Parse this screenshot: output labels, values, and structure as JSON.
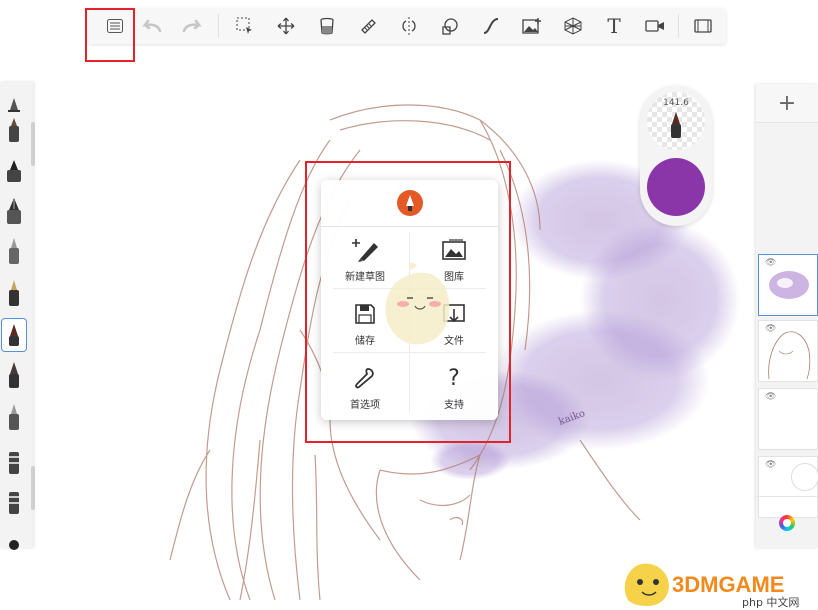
{
  "toolbar": {
    "tools": [
      "menu-icon",
      "undo-icon",
      "redo-icon",
      "selection-icon",
      "transform-icon",
      "fill-icon",
      "ruler-icon",
      "symmetry-icon",
      "shape-icon",
      "curve-icon",
      "add-image-icon",
      "perspective-icon",
      "text-icon",
      "video-icon",
      "layout-icon"
    ]
  },
  "left_dock": {
    "brushes": [
      "brush-1",
      "brush-2",
      "brush-3",
      "brush-4",
      "brush-5",
      "brush-6",
      "brush-7",
      "brush-8",
      "brush-9",
      "brush-10",
      "brush-11",
      "brush-12"
    ],
    "selected_index": 6
  },
  "brush_puck": {
    "size": "141.6",
    "color": "#8b36a8"
  },
  "right_dock": {
    "add_label": "+",
    "layers": [
      "layer-1",
      "layer-2",
      "layer-3",
      "layer-4"
    ],
    "selected_layer": 0
  },
  "main_menu": {
    "items": [
      {
        "label": "新建草图",
        "icon": "new-sketch-icon"
      },
      {
        "label": "图库",
        "icon": "gallery-icon"
      },
      {
        "label": "储存",
        "icon": "save-icon"
      },
      {
        "label": "文件",
        "icon": "file-icon"
      },
      {
        "label": "首选项",
        "icon": "preferences-icon"
      },
      {
        "label": "支持",
        "icon": "support-icon"
      }
    ]
  },
  "canvas": {
    "signature": "kaiko"
  },
  "watermark": {
    "brand": "3DMGAME",
    "site": "php 中文网"
  },
  "colors": {
    "highlight": "#e3232a",
    "accent": "#8b36a8",
    "selection": "#5a8fd8"
  }
}
